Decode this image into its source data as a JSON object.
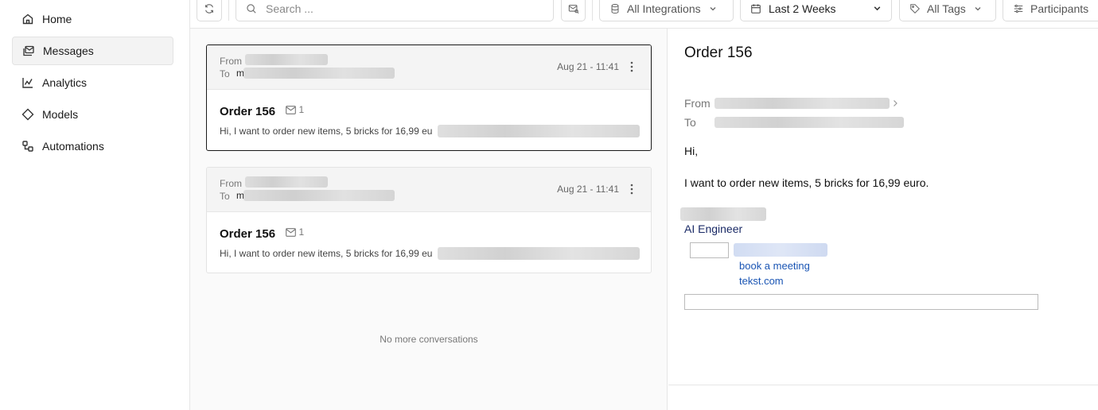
{
  "sidebar": {
    "items": [
      {
        "label": "Home",
        "icon": "home-icon"
      },
      {
        "label": "Messages",
        "icon": "messages-icon",
        "active": true
      },
      {
        "label": "Analytics",
        "icon": "analytics-icon"
      },
      {
        "label": "Models",
        "icon": "models-icon"
      },
      {
        "label": "Automations",
        "icon": "automations-icon"
      }
    ]
  },
  "toolbar": {
    "search_placeholder": "Search ...",
    "integrations_label": "All Integrations",
    "date_label": "Last 2 Weeks",
    "tags_label": "All Tags",
    "participants_label": "Participants"
  },
  "list": {
    "conversations": [
      {
        "from_label": "From",
        "to_label": "To",
        "to_initial": "m",
        "date": "Aug 21 - 11:41",
        "subject": "Order 156",
        "count": "1",
        "snippet": "Hi, I want to order new items, 5 bricks for 16,99 eu"
      },
      {
        "from_label": "From",
        "to_label": "To",
        "to_initial": "m",
        "date": "Aug 21 - 11:41",
        "subject": "Order 156",
        "count": "1",
        "snippet": "Hi, I want to order new items, 5 bricks for 16,99 eu"
      }
    ],
    "end_text": "No more conversations"
  },
  "detail": {
    "title": "Order 156",
    "from_label": "From",
    "to_label": "To",
    "greeting": "Hi,",
    "body": "I want to order new items, 5 bricks for 16,99 euro.",
    "signature_role": "AI Engineer",
    "link_meeting": "book a meeting",
    "link_site": "tekst.com"
  },
  "colors": {
    "accent_link": "#1a55b4",
    "selected_border": "#1a1a1a"
  }
}
